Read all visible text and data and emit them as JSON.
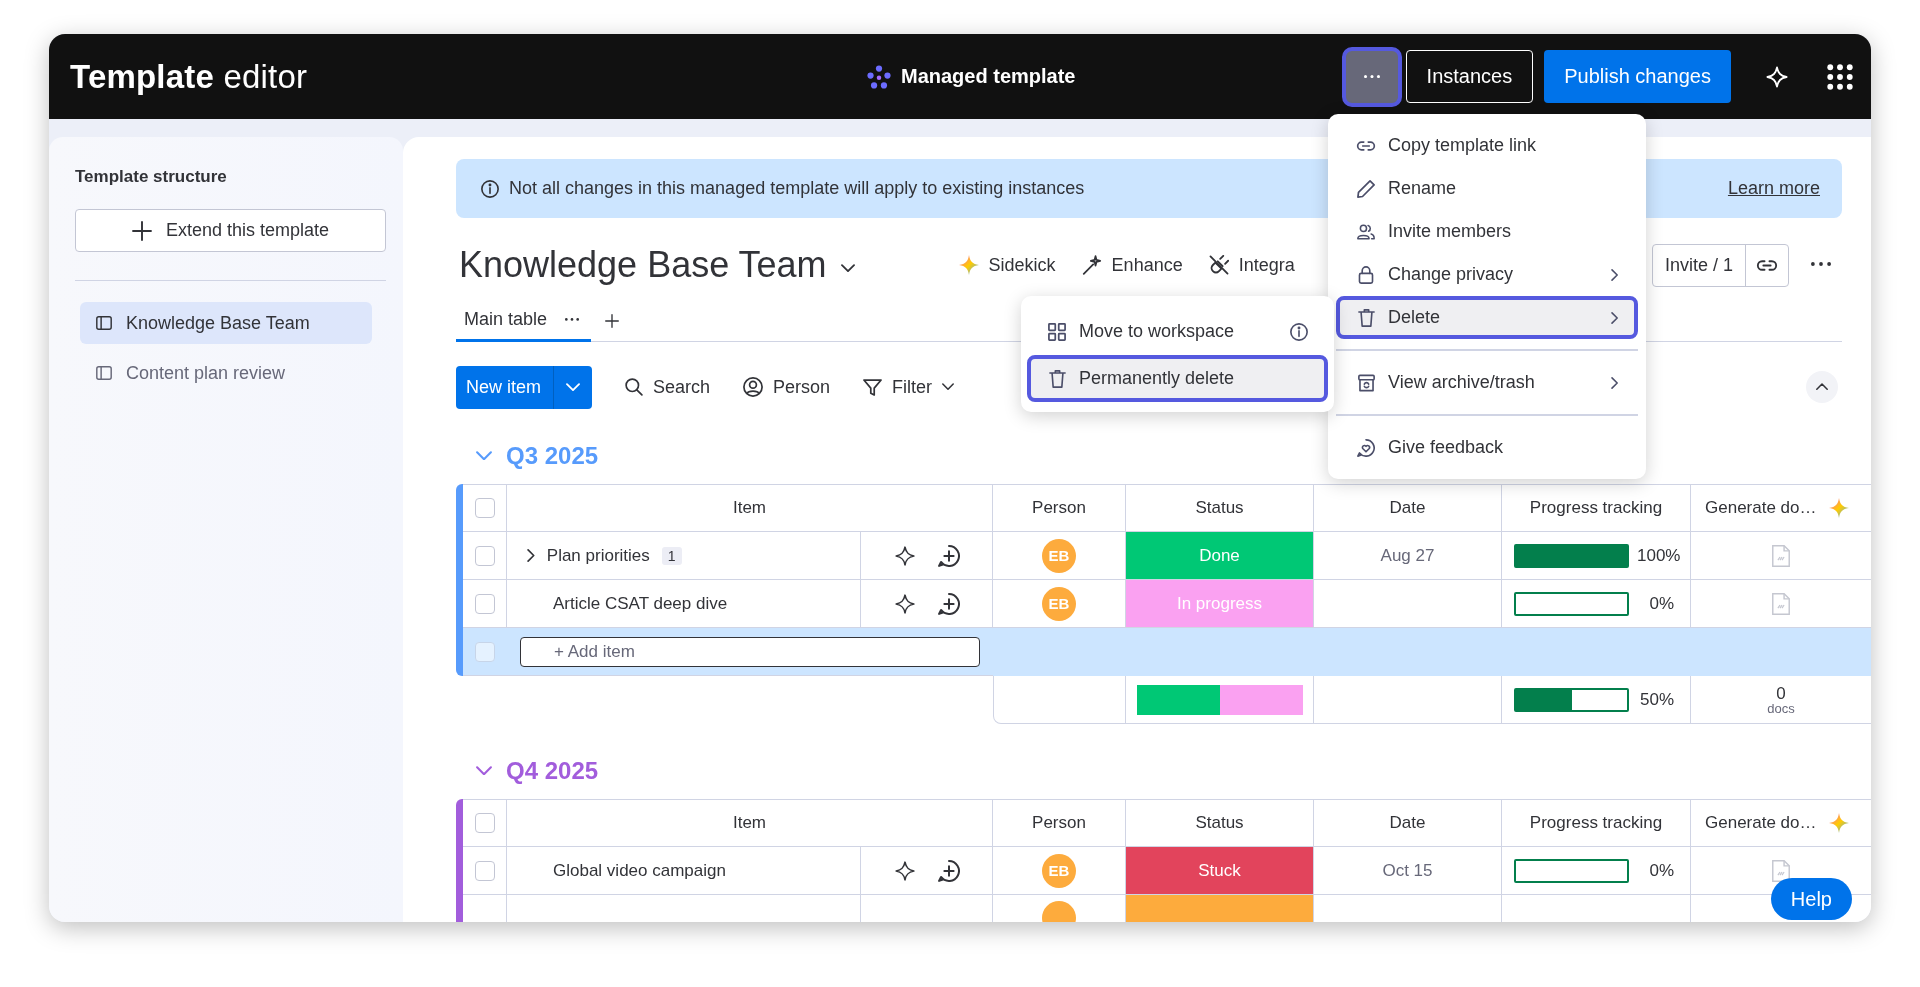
{
  "header": {
    "title_bold": "Template",
    "title_rest": "editor",
    "center_label": "Managed template",
    "more_button": {
      "selected": true
    },
    "buttons": [
      {
        "label": "Instances",
        "kind": "outline"
      },
      {
        "label": "Publish changes",
        "kind": "primary"
      }
    ]
  },
  "sidebar": {
    "title": "Template structure",
    "extend_button": "Extend this template",
    "items": [
      {
        "label": "Knowledge Base Team",
        "selected": true
      },
      {
        "label": "Content plan review",
        "selected": false
      }
    ]
  },
  "banner": {
    "text": "Not all changes in this managed template will apply to existing instances",
    "link": "Learn more"
  },
  "board": {
    "title": "Knowledge Base Team",
    "actions": [
      "Sidekick",
      "Enhance",
      "Integra"
    ],
    "invite_button": "Invite / 1",
    "tabs": [
      {
        "label": "Main table",
        "selected": true
      }
    ],
    "toolbar": {
      "new_item": "New item",
      "tools": [
        "Search",
        "Person",
        "Filter"
      ]
    },
    "groups": [
      {
        "title": "Q3 2025",
        "color": "#579bfc",
        "header_checkbox": {
          "checked": false
        },
        "columns": [
          "Item",
          "Person",
          "Status",
          "Date",
          "Progress tracking",
          "Generate do…"
        ],
        "rows": [
          {
            "item": "Plan priorities",
            "subitems": "1",
            "checked": false,
            "person": "EB",
            "status": "Done",
            "color": "#00c875",
            "date": "Aug 27",
            "level": 1,
            "reading": "100%"
          },
          {
            "item": "Article CSAT deep dive",
            "checked": false,
            "person": "EB",
            "status": "In progress",
            "color": "#faa1f1",
            "level": 0,
            "reading": "0%"
          }
        ],
        "add_item": {
          "label": "+ Add item",
          "checked": false
        },
        "summary": {
          "segments": [
            {
              "color": "#00c875",
              "level": 0.5
            },
            {
              "color": "#faa1f1",
              "level": 0.5
            }
          ],
          "level": 0.5,
          "reading": "50%",
          "docs_count": "0",
          "docs_label": "docs"
        }
      },
      {
        "title": "Q4 2025",
        "color": "#a25ddc",
        "header_checkbox": {
          "checked": false
        },
        "columns": [
          "Item",
          "Person",
          "Status",
          "Date",
          "Progress tracking",
          "Generate do…"
        ],
        "rows": [
          {
            "item": "Global video campaign",
            "checked": false,
            "person": "EB",
            "status": "Stuck",
            "color": "#e2445c",
            "date": "Oct 15",
            "level": 0,
            "reading": "0%"
          },
          {
            "color": "#fdab3d"
          }
        ]
      }
    ]
  },
  "menu": {
    "items": [
      {
        "kind": "item",
        "label": "Copy template link",
        "submenu": false,
        "selected": false
      },
      {
        "kind": "item",
        "label": "Rename",
        "submenu": false,
        "selected": false
      },
      {
        "kind": "item",
        "label": "Invite members",
        "submenu": false,
        "selected": false
      },
      {
        "kind": "item",
        "label": "Change privacy",
        "submenu": true,
        "selected": false
      },
      {
        "kind": "item",
        "label": "Delete",
        "submenu": true,
        "selected": true
      },
      {
        "kind": "divider"
      },
      {
        "kind": "item",
        "label": "View archive/trash",
        "submenu": true,
        "selected": false
      },
      {
        "kind": "divider"
      },
      {
        "kind": "item",
        "label": "Give feedback",
        "submenu": false,
        "selected": false
      }
    ]
  },
  "submenu": {
    "items": [
      {
        "label": "Move to workspace",
        "info": true,
        "selected": false
      },
      {
        "label": "Permanently delete",
        "info": false,
        "selected": true
      }
    ]
  },
  "help_button": "Help"
}
